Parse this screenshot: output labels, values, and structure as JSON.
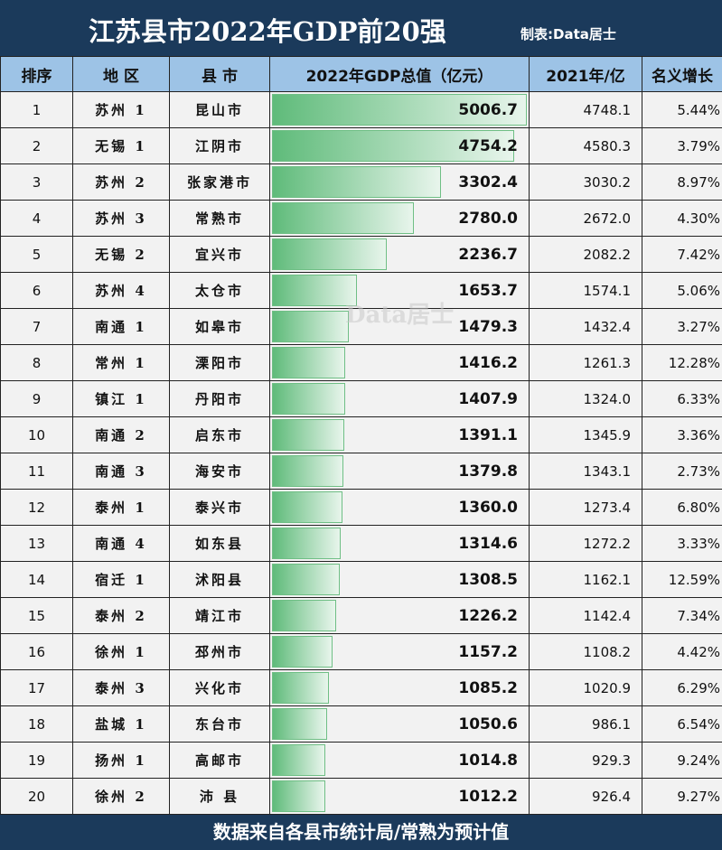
{
  "title": "江苏县市2022年GDP前20强",
  "credit": "制表:Data居士",
  "watermark": "Data居士",
  "headers": [
    "排序",
    "地 区",
    "县 市",
    "2022年GDP总值（亿元）",
    "2021年/亿",
    "名义增长"
  ],
  "rows": [
    [
      "1",
      "苏州 1",
      "昆山市",
      5006.7,
      "4748.1",
      "5.44%"
    ],
    [
      "2",
      "无锡 1",
      "江阴市",
      4754.2,
      "4580.3",
      "3.79%"
    ],
    [
      "3",
      "苏州 2",
      "张家港市",
      3302.4,
      "3030.2",
      "8.97%"
    ],
    [
      "4",
      "苏州 3",
      "常熟市",
      2780.0,
      "2672.0",
      "4.30%"
    ],
    [
      "5",
      "无锡 2",
      "宜兴市",
      2236.7,
      "2082.2",
      "7.42%"
    ],
    [
      "6",
      "苏州 4",
      "太仓市",
      1653.7,
      "1574.1",
      "5.06%"
    ],
    [
      "7",
      "南通 1",
      "如皋市",
      1479.3,
      "1432.4",
      "3.27%"
    ],
    [
      "8",
      "常州 1",
      "溧阳市",
      1416.2,
      "1261.3",
      "12.28%"
    ],
    [
      "9",
      "镇江 1",
      "丹阳市",
      1407.9,
      "1324.0",
      "6.33%"
    ],
    [
      "10",
      "南通 2",
      "启东市",
      1391.1,
      "1345.9",
      "3.36%"
    ],
    [
      "11",
      "南通 3",
      "海安市",
      1379.8,
      "1343.1",
      "2.73%"
    ],
    [
      "12",
      "泰州 1",
      "泰兴市",
      1360.0,
      "1273.4",
      "6.80%"
    ],
    [
      "13",
      "南通 4",
      "如东县",
      1314.6,
      "1272.2",
      "3.33%"
    ],
    [
      "14",
      "宿迁 1",
      "沭阳县",
      1308.5,
      "1162.1",
      "12.59%"
    ],
    [
      "15",
      "泰州 2",
      "靖江市",
      1226.2,
      "1142.4",
      "7.34%"
    ],
    [
      "16",
      "徐州 1",
      "邳州市",
      1157.2,
      "1108.2",
      "4.42%"
    ],
    [
      "17",
      "泰州 3",
      "兴化市",
      1085.2,
      "1020.9",
      "6.29%"
    ],
    [
      "18",
      "盐城 1",
      "东台市",
      1050.6,
      "986.1",
      "6.54%"
    ],
    [
      "19",
      "扬州 1",
      "高邮市",
      1014.8,
      "929.3",
      "9.24%"
    ],
    [
      "20",
      "徐州 2",
      "沛 县",
      1012.2,
      "926.4",
      "9.27%"
    ]
  ],
  "footer": "数据来自各县市统计局/常熟为预计值"
}
